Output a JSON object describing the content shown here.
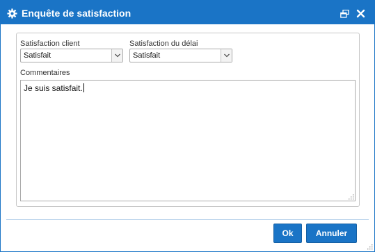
{
  "window": {
    "title": "Enquête de satisfaction",
    "icon": "gear-icon",
    "controls": [
      "restore-icon",
      "close-icon"
    ],
    "accent_color": "#1a74c6"
  },
  "form": {
    "satisfaction_client": {
      "label": "Satisfaction client",
      "value": "Satisfait"
    },
    "satisfaction_delai": {
      "label": "Satisfaction du délai",
      "value": "Satisfait"
    },
    "comments": {
      "label": "Commentaires",
      "value": "Je suis satisfait."
    }
  },
  "buttons": {
    "ok_label": "Ok",
    "cancel_label": "Annuler"
  }
}
